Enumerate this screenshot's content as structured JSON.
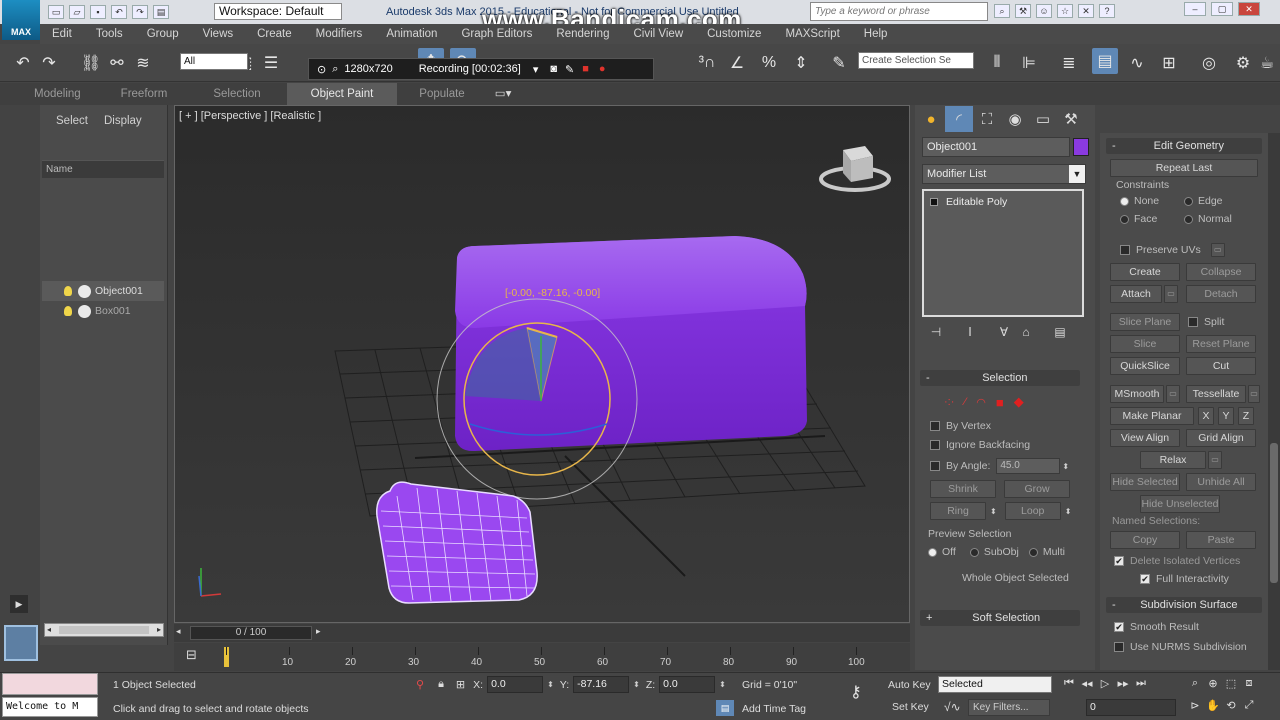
{
  "titlebar": {
    "app_logo": "MAX",
    "workspace": "Workspace: Default",
    "window_title": "Autodesk 3ds Max 2015 - Educational - Not for Commercial Use     Untitled",
    "search_placeholder": "Type a keyword or phrase",
    "watermark": "www.Bandicam.com"
  },
  "menu": [
    "Edit",
    "Tools",
    "Group",
    "Views",
    "Create",
    "Modifiers",
    "Animation",
    "Graph Editors",
    "Rendering",
    "Civil View",
    "Customize",
    "MAXScript",
    "Help"
  ],
  "toolbar": {
    "selection_filter": "All",
    "named_selection": "Create Selection Se",
    "recording": {
      "resolution": "1280x720",
      "status": "Recording [00:02:36]"
    }
  },
  "ribbon_tabs": [
    {
      "label": "Modeling",
      "active": false
    },
    {
      "label": "Freeform",
      "active": false
    },
    {
      "label": "Selection",
      "active": false
    },
    {
      "label": "Object Paint",
      "active": true
    },
    {
      "label": "Populate",
      "active": false
    }
  ],
  "explorer": {
    "tabs": [
      "Select",
      "Display"
    ],
    "column_header": "Name",
    "objects": [
      {
        "name": "Object001",
        "selected": true
      },
      {
        "name": "Box001",
        "selected": false
      }
    ]
  },
  "viewport": {
    "label": "[ + ] [Perspective ] [Realistic ]",
    "gizmo_readout": "[-0.00, -87.16, -0.00]"
  },
  "command_panel": {
    "object_name": "Object001",
    "object_color": "#8a3ae0",
    "modifier_list": "Modifier List",
    "stack": [
      "Editable Poly"
    ],
    "selection": {
      "title": "Selection",
      "by_vertex": "By Vertex",
      "ignore_backfacing": "Ignore Backfacing",
      "by_angle": "By Angle:",
      "angle_value": "45.0",
      "shrink": "Shrink",
      "grow": "Grow",
      "ring": "Ring",
      "loop": "Loop",
      "preview_title": "Preview Selection",
      "preview_off": "Off",
      "preview_subobj": "SubObj",
      "preview_multi": "Multi",
      "whole_object": "Whole Object Selected"
    },
    "soft_selection": "Soft Selection"
  },
  "edit_geometry": {
    "title": "Edit Geometry",
    "repeat_last": "Repeat Last",
    "constraints": "Constraints",
    "c_none": "None",
    "c_edge": "Edge",
    "c_face": "Face",
    "c_normal": "Normal",
    "preserve_uvs": "Preserve UVs",
    "create": "Create",
    "collapse": "Collapse",
    "attach": "Attach",
    "detach": "Detach",
    "slice_plane": "Slice Plane",
    "split": "Split",
    "slice": "Slice",
    "reset_plane": "Reset Plane",
    "quickslice": "QuickSlice",
    "cut": "Cut",
    "msmooth": "MSmooth",
    "tessellate": "Tessellate",
    "make_planar": "Make Planar",
    "x": "X",
    "y": "Y",
    "z": "Z",
    "view_align": "View Align",
    "grid_align": "Grid Align",
    "relax": "Relax",
    "hide_selected": "Hide Selected",
    "unhide_all": "Unhide All",
    "hide_unselected": "Hide Unselected",
    "named_selections": "Named Selections:",
    "copy": "Copy",
    "paste": "Paste",
    "delete_isolated": "Delete Isolated Vertices",
    "full_interactivity": "Full Interactivity",
    "subdivision_title": "Subdivision Surface",
    "smooth_result": "Smooth Result",
    "use_nurms": "Use NURMS Subdivision"
  },
  "timeline": {
    "position": "0 / 100",
    "ticks": [
      "10",
      "20",
      "30",
      "40",
      "50",
      "60",
      "70",
      "80",
      "90",
      "100"
    ]
  },
  "status": {
    "maxscript_text": "Welcome to M",
    "selection_count": "1 Object Selected",
    "prompt": "Click and drag to select and rotate objects",
    "x_label": "X:",
    "x_value": "0.0",
    "y_label": "Y:",
    "y_value": "-87.16",
    "z_label": "Z:",
    "z_value": "0.0",
    "grid": "Grid = 0'10\"",
    "add_time_tag": "Add Time Tag",
    "auto_key": "Auto Key",
    "set_key": "Set Key",
    "selected": "Selected",
    "key_filters": "Key Filters...",
    "frame": "0"
  }
}
